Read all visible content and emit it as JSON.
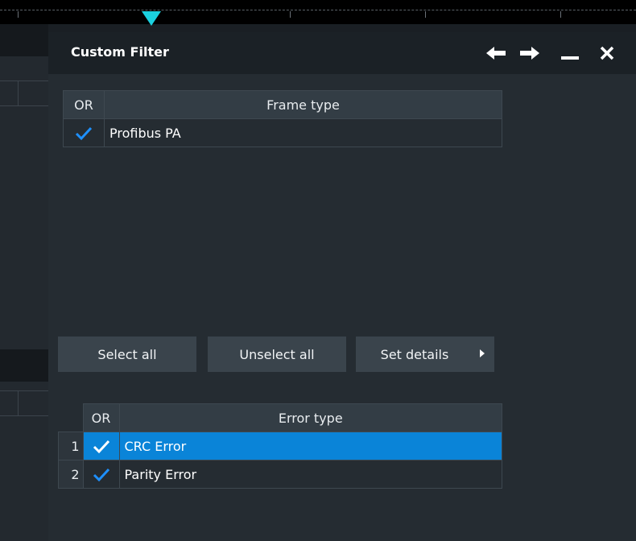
{
  "dialog": {
    "title": "Custom Filter"
  },
  "frame_table": {
    "columns": [
      "OR",
      "Frame type"
    ],
    "rows": [
      {
        "checked": true,
        "label": "Profibus PA"
      }
    ]
  },
  "buttons": {
    "select_all": "Select all",
    "unselect_all": "Unselect all",
    "set_details": "Set details"
  },
  "error_table": {
    "columns": [
      "OR",
      "Error type"
    ],
    "rows": [
      {
        "index": "1",
        "checked": true,
        "label": "CRC Error",
        "selected": true
      },
      {
        "index": "2",
        "checked": true,
        "label": "Parity Error",
        "selected": false
      }
    ]
  },
  "colors": {
    "accent": "#0a84d8",
    "checkmark": "#1e90ff",
    "trigger_marker": "#1bd1e0"
  }
}
